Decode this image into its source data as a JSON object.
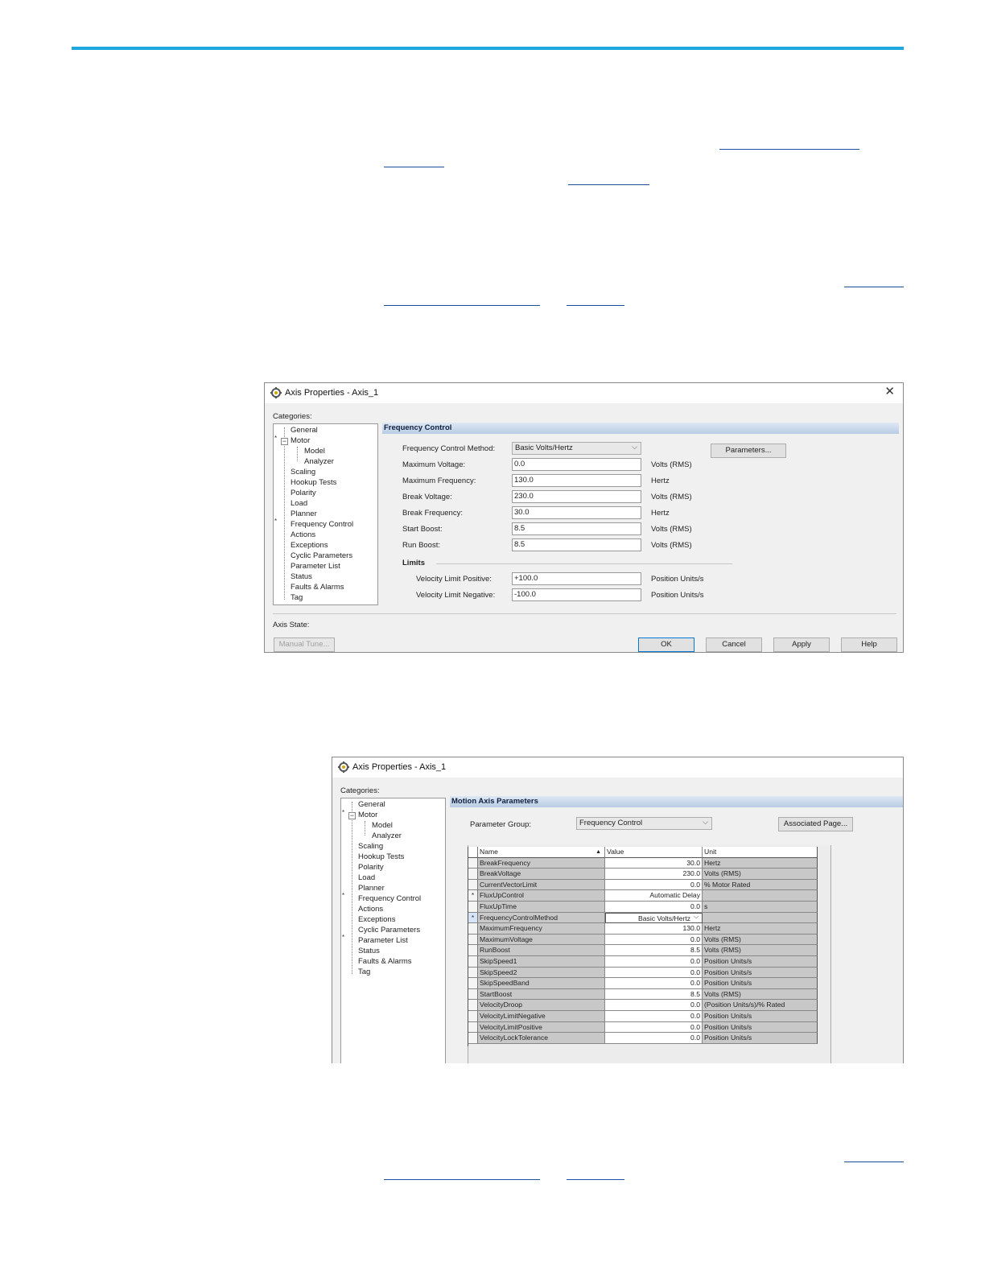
{
  "dialog1": {
    "title": "Axis Properties - Axis_1",
    "categories_label": "Categories:",
    "tree": [
      "General",
      "Motor",
      "Model",
      "Analyzer",
      "Scaling",
      "Hookup Tests",
      "Polarity",
      "Load",
      "Planner",
      "Frequency Control",
      "Actions",
      "Exceptions",
      "Cyclic Parameters",
      "Parameter List",
      "Status",
      "Faults & Alarms",
      "Tag"
    ],
    "section_title": "Frequency Control",
    "fields": [
      {
        "label": "Frequency Control Method:",
        "value": "Basic Volts/Hertz",
        "unit": ""
      },
      {
        "label": "Maximum Voltage:",
        "value": "0.0",
        "unit": "Volts (RMS)"
      },
      {
        "label": "Maximum Frequency:",
        "value": "130.0",
        "unit": "Hertz"
      },
      {
        "label": "Break Voltage:",
        "value": "230.0",
        "unit": "Volts (RMS)"
      },
      {
        "label": "Break Frequency:",
        "value": "30.0",
        "unit": "Hertz"
      },
      {
        "label": "Start Boost:",
        "value": "8.5",
        "unit": "Volts (RMS)"
      },
      {
        "label": "Run Boost:",
        "value": "8.5",
        "unit": "Volts (RMS)"
      }
    ],
    "parameters_button": "Parameters...",
    "limits_label": "Limits",
    "limits": [
      {
        "label": "Velocity Limit Positive:",
        "value": "+100.0",
        "unit": "Position Units/s"
      },
      {
        "label": "Velocity Limit Negative:",
        "value": "-100.0",
        "unit": "Position Units/s"
      }
    ],
    "axis_state_label": "Axis State:",
    "buttons": {
      "manual_tune": "Manual Tune...",
      "ok": "OK",
      "cancel": "Cancel",
      "apply": "Apply",
      "help": "Help"
    }
  },
  "dialog2": {
    "title": "Axis Properties - Axis_1",
    "categories_label": "Categories:",
    "tree": [
      "General",
      "Motor",
      "Model",
      "Analyzer",
      "Scaling",
      "Hookup Tests",
      "Polarity",
      "Load",
      "Planner",
      "Frequency Control",
      "Actions",
      "Exceptions",
      "Cyclic Parameters",
      "Parameter List",
      "Status",
      "Faults & Alarms",
      "Tag"
    ],
    "section_title": "Motion Axis Parameters",
    "param_group_label": "Parameter Group:",
    "param_group_value": "Frequency Control",
    "associated_button": "Associated Page...",
    "columns": [
      "Name",
      "Value",
      "Unit"
    ],
    "rows": [
      {
        "mark": "",
        "name": "BreakFrequency",
        "value": "30.0",
        "unit": "Hertz"
      },
      {
        "mark": "",
        "name": "BreakVoltage",
        "value": "230.0",
        "unit": "Volts (RMS)"
      },
      {
        "mark": "",
        "name": "CurrentVectorLimit",
        "value": "0.0",
        "unit": "% Motor Rated"
      },
      {
        "mark": "*",
        "name": "FluxUpControl",
        "value": "Automatic Delay",
        "unit": ""
      },
      {
        "mark": "",
        "name": "FluxUpTime",
        "value": "0.0",
        "unit": "s"
      },
      {
        "mark": "*",
        "name": "FrequencyControlMethod",
        "value": "Basic Volts/Hertz",
        "unit": ""
      },
      {
        "mark": "",
        "name": "MaximumFrequency",
        "value": "130.0",
        "unit": "Hertz"
      },
      {
        "mark": "",
        "name": "MaximumVoltage",
        "value": "0.0",
        "unit": "Volts (RMS)"
      },
      {
        "mark": "",
        "name": "RunBoost",
        "value": "8.5",
        "unit": "Volts (RMS)"
      },
      {
        "mark": "",
        "name": "SkipSpeed1",
        "value": "0.0",
        "unit": "Position Units/s"
      },
      {
        "mark": "",
        "name": "SkipSpeed2",
        "value": "0.0",
        "unit": "Position Units/s"
      },
      {
        "mark": "",
        "name": "SkipSpeedBand",
        "value": "0.0",
        "unit": "Position Units/s"
      },
      {
        "mark": "",
        "name": "StartBoost",
        "value": "8.5",
        "unit": "Volts (RMS)"
      },
      {
        "mark": "",
        "name": "VelocityDroop",
        "value": "0.0",
        "unit": "(Position Units/s)/% Rated"
      },
      {
        "mark": "",
        "name": "VelocityLimitNegative",
        "value": "0.0",
        "unit": "Position Units/s"
      },
      {
        "mark": "",
        "name": "VelocityLimitPositive",
        "value": "0.0",
        "unit": "Position Units/s"
      },
      {
        "mark": "",
        "name": "VelocityLockTolerance",
        "value": "0.0",
        "unit": "Position Units/s"
      }
    ]
  },
  "colors": {
    "accent_rule": "#1fa8e0",
    "section_header": "#b8cce4",
    "link": "#1f4e9c"
  }
}
